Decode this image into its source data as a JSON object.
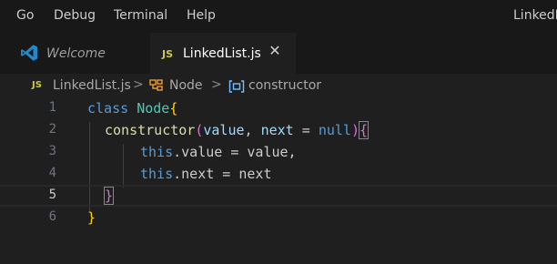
{
  "menubar": {
    "items": [
      "Go",
      "Debug",
      "Terminal",
      "Help"
    ],
    "window_title": "LinkedL"
  },
  "tabs": {
    "welcome_label": "Welcome",
    "active_badge": "JS",
    "active_label": "LinkedList.js",
    "close_glyph": "✕"
  },
  "breadcrumb": {
    "badge": "JS",
    "file": "LinkedList.js",
    "separator": ">",
    "class_name": "Node",
    "method_name": "constructor",
    "class_icon": "symbol-class-icon",
    "method_icon": "symbol-method-icon"
  },
  "editor": {
    "line_numbers": [
      "1",
      "2",
      "3",
      "4",
      "5",
      "6"
    ],
    "active_line": 5,
    "lines": {
      "l1": {
        "kw": "class",
        "name": "Node",
        "brace": "{"
      },
      "l2": {
        "fn": "constructor",
        "open": "(",
        "p1": "value",
        "comma": ",",
        "p2": "next",
        "eq": "=",
        "null": "null",
        "close": ")",
        "brace": "{"
      },
      "l3": {
        "this": "this",
        "rest": ".value = value,"
      },
      "l4": {
        "this": "this",
        "rest": ".next = next"
      },
      "l5": {
        "brace": "}"
      },
      "l6": {
        "brace": "}"
      }
    }
  },
  "colors": {
    "keyword": "#569cd6",
    "class": "#4ec9b0",
    "function": "#dcdcaa",
    "parameter": "#9cdcfe",
    "bracket_level_1": "#ffd700",
    "bracket_level_2": "#da70d6",
    "js_badge": "#cbcb41",
    "vscode_logo": "#2489ca"
  }
}
